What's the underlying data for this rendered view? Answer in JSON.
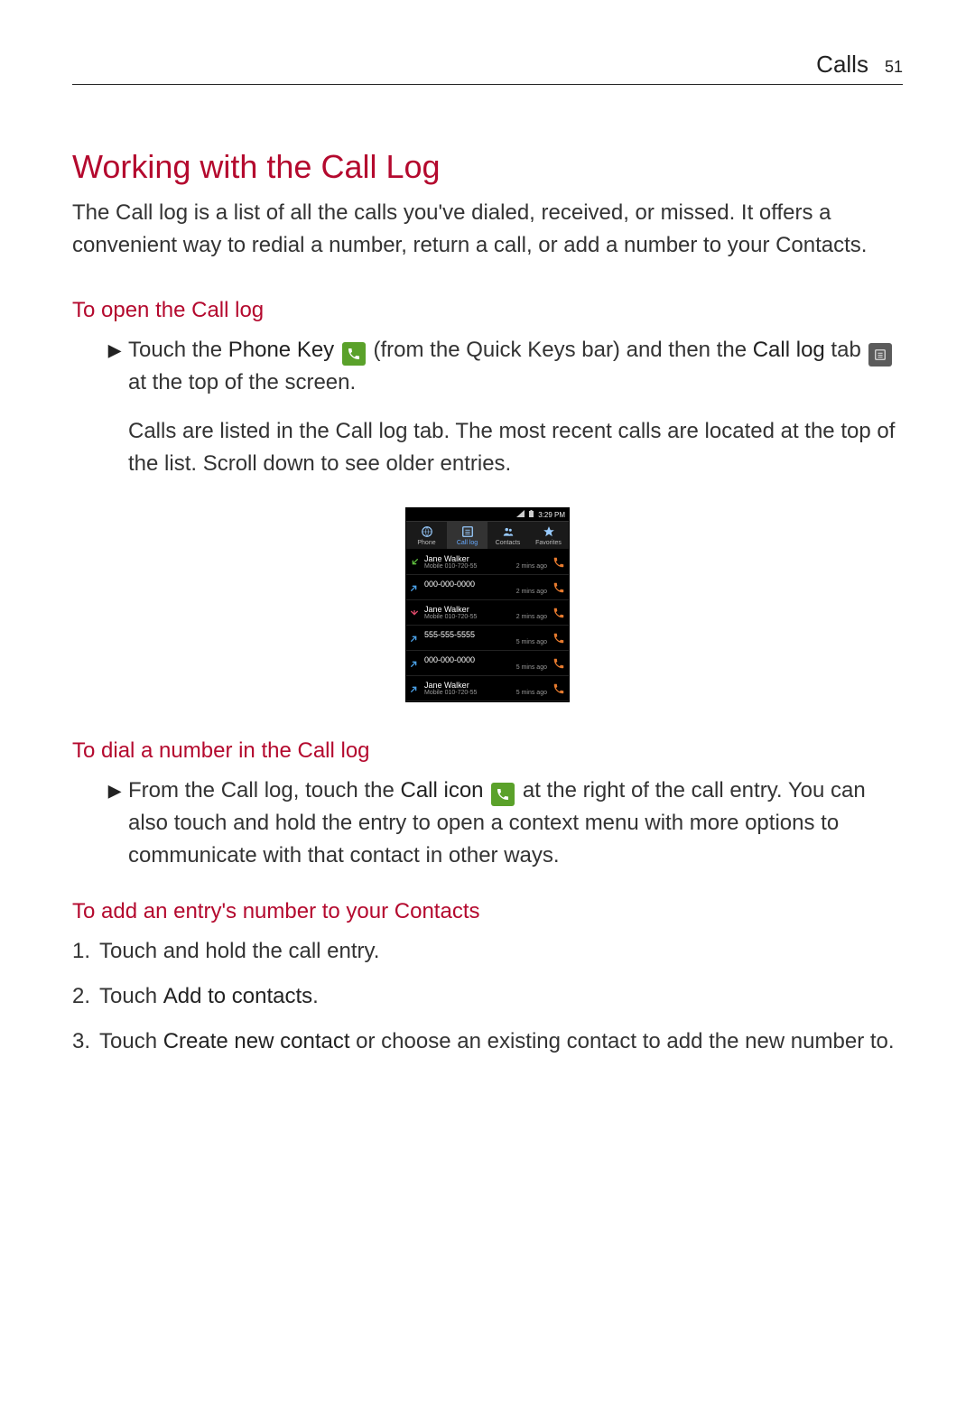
{
  "header": {
    "section": "Calls",
    "page": "51"
  },
  "title": "Working with the Call Log",
  "intro": "The Call log is a list of all the calls you've dialed, received, or missed. It offers a convenient way to redial a number, return a call, or add a number to your Contacts.",
  "section_open": {
    "heading": "To open the Call log",
    "bullet_pre": "Touch the ",
    "phone_key_bold": "Phone Key",
    "bullet_mid1": " (from the Quick Keys bar) and then the ",
    "call_log_bold": "Call log",
    "bullet_mid2": " tab ",
    "bullet_post": " at the top of the screen.",
    "follow_pre": "Calls are listed in the ",
    "follow_bold": "Call log",
    "follow_post": " tab. The most recent calls are located at the top of the list. Scroll down to see older entries."
  },
  "screenshot": {
    "status_time": "3:29 PM",
    "tabs": [
      {
        "label": "Phone",
        "active": false
      },
      {
        "label": "Call log",
        "active": true
      },
      {
        "label": "Contacts",
        "active": false
      },
      {
        "label": "Favorites",
        "active": false
      }
    ],
    "entries": [
      {
        "type": "incoming",
        "name": "Jane Walker",
        "sub": "Mobile 010-720-55",
        "time": "2 mins ago"
      },
      {
        "type": "outgoing",
        "name": "000-000-0000",
        "sub": "",
        "time": "2 mins ago"
      },
      {
        "type": "missed",
        "name": "Jane Walker",
        "sub": "Mobile 010-720-55",
        "time": "2 mins ago"
      },
      {
        "type": "outgoing",
        "name": "555-555-5555",
        "sub": "",
        "time": "5 mins ago"
      },
      {
        "type": "outgoing",
        "name": "000-000-0000",
        "sub": "",
        "time": "5 mins ago"
      },
      {
        "type": "outgoing",
        "name": "Jane Walker",
        "sub": "Mobile 010-720-55",
        "time": "5 mins ago"
      }
    ]
  },
  "section_dial": {
    "heading": "To dial a number in the Call log",
    "bullet_pre": "From the Call log, touch the ",
    "call_icon_bold": "Call icon",
    "bullet_post": " at the right of the call entry. You can also touch and hold the entry to open a context menu with more options to communicate with that contact in other ways."
  },
  "section_add": {
    "heading": "To add an entry's number to your Contacts",
    "steps": {
      "s1_num": "1.",
      "s1_text": "Touch and hold the call entry.",
      "s2_num": "2.",
      "s2_pre": "Touch ",
      "s2_bold": "Add to contacts",
      "s2_post": ".",
      "s3_num": "3.",
      "s3_pre": "Touch ",
      "s3_bold": "Create new contact",
      "s3_post": " or choose an existing contact to add the new number to."
    }
  }
}
